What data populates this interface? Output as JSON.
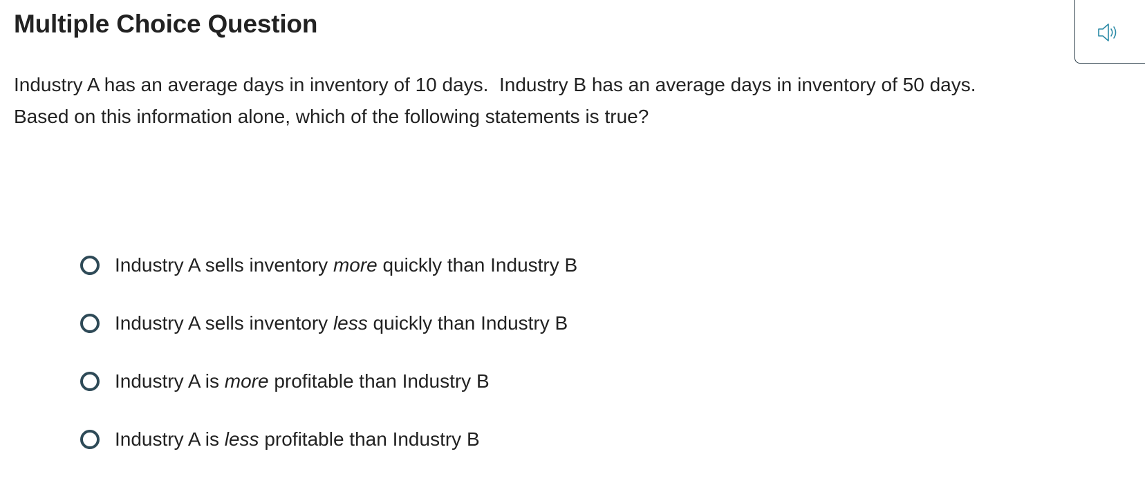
{
  "header": {
    "title": "Multiple Choice Question",
    "audio_button_icon": "speaker-icon"
  },
  "question": {
    "line1": "Industry A has an average days in inventory of 10 days.  Industry B has an average days in inventory of 50 days.",
    "line2": "Based on this information alone, which of the following statements is true?"
  },
  "options": [
    {
      "before": "Industry A sells inventory ",
      "emphasis": "more",
      "after": " quickly than Industry B",
      "selected": false
    },
    {
      "before": "Industry A sells inventory ",
      "emphasis": "less",
      "after": " quickly than Industry B",
      "selected": false
    },
    {
      "before": "Industry A is ",
      "emphasis": "more",
      "after": " profitable than Industry B",
      "selected": false
    },
    {
      "before": "Industry A is ",
      "emphasis": "less",
      "after": " profitable than Industry B",
      "selected": false
    }
  ],
  "colors": {
    "radio_border": "#2e4a57",
    "audio_icon": "#2a8aa6",
    "text": "#222222"
  }
}
